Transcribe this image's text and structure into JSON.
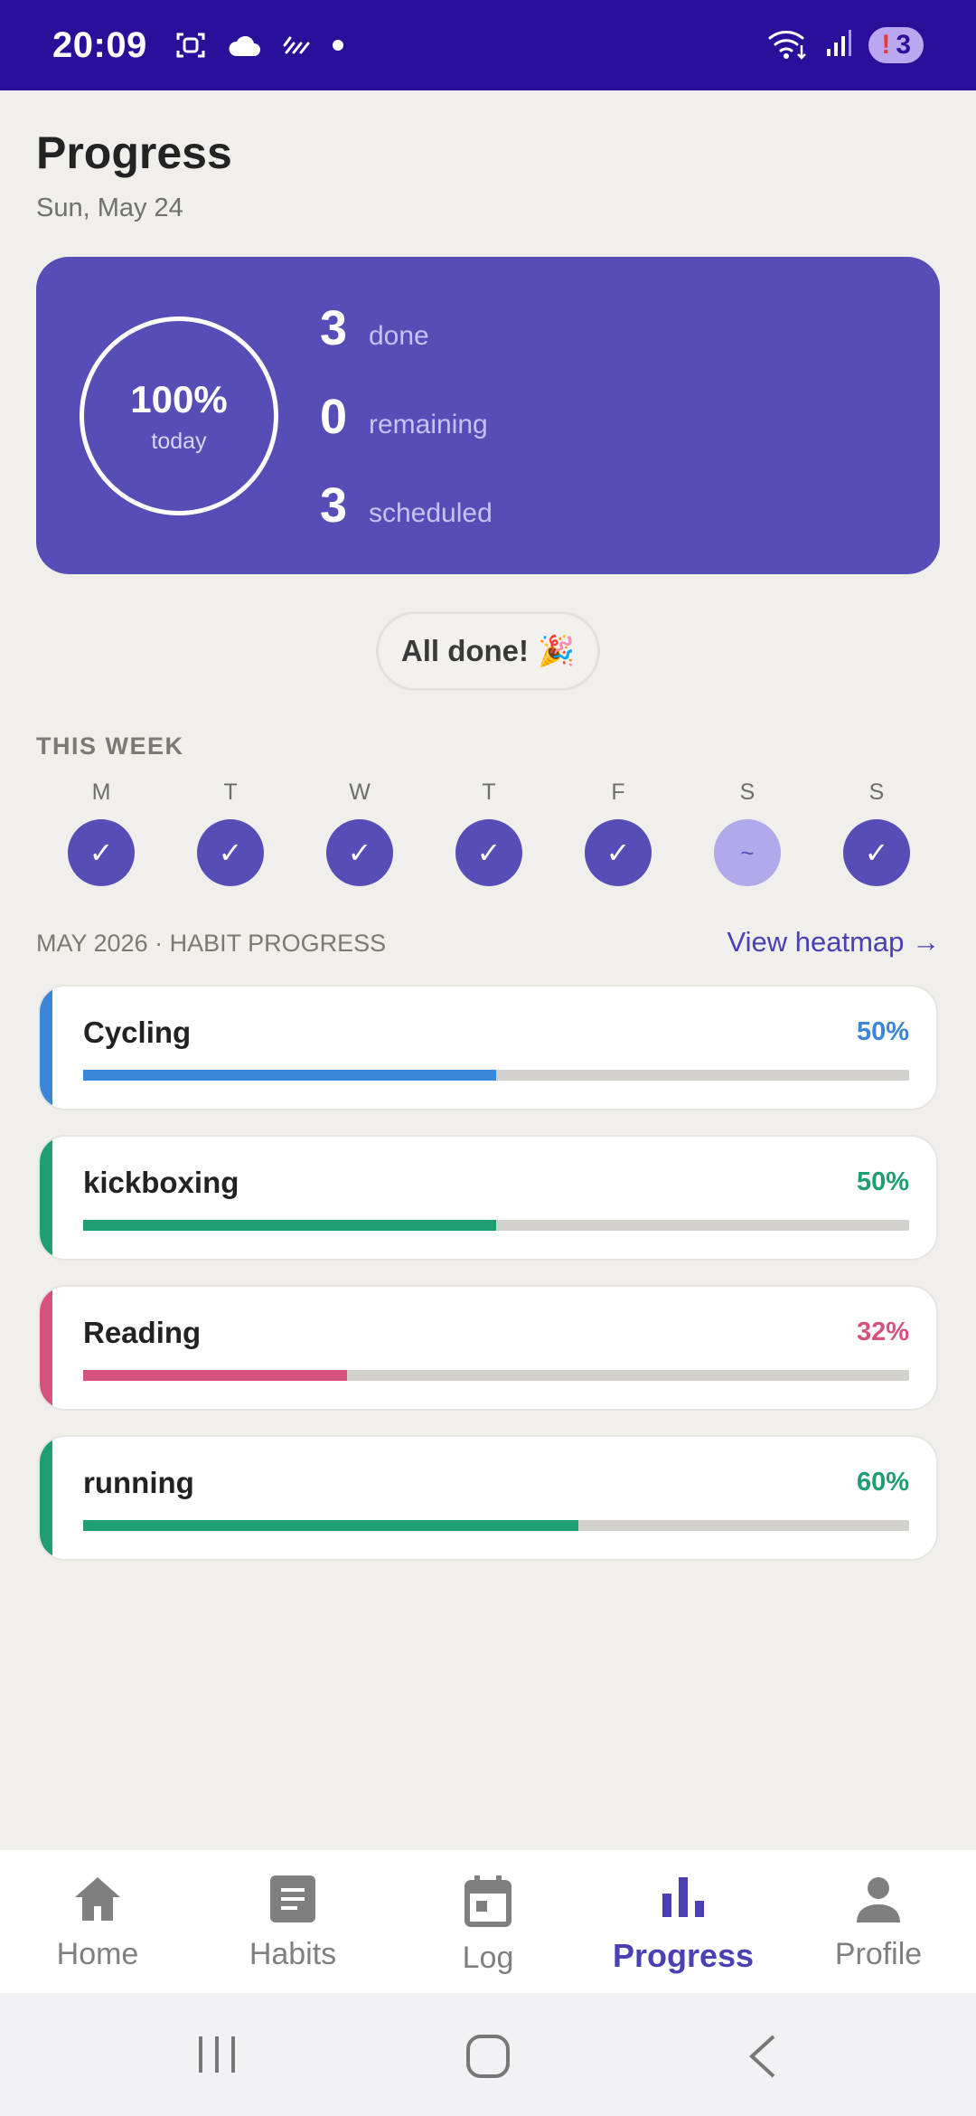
{
  "status_bar": {
    "time": "20:09",
    "notification_count": "3",
    "notification_bang": "!",
    "icons": [
      "screenshot-icon",
      "cloud-icon",
      "weather-icon",
      "dot-icon",
      "wifi-icon",
      "signal-icon"
    ]
  },
  "header": {
    "title": "Progress",
    "date": "Sun, May 24"
  },
  "summary": {
    "percent": "100%",
    "percent_label": "today",
    "percent_value": 1.0,
    "stats": [
      {
        "number": "3",
        "label": "done"
      },
      {
        "number": "0",
        "label": "remaining"
      },
      {
        "number": "3",
        "label": "scheduled"
      }
    ]
  },
  "all_done": {
    "label": "All done!",
    "emoji": "🎉"
  },
  "week": {
    "title": "THIS WEEK",
    "days": [
      {
        "letter": "M",
        "mark": "✓",
        "state": "done"
      },
      {
        "letter": "T",
        "mark": "✓",
        "state": "done"
      },
      {
        "letter": "W",
        "mark": "✓",
        "state": "done"
      },
      {
        "letter": "T",
        "mark": "✓",
        "state": "done"
      },
      {
        "letter": "F",
        "mark": "✓",
        "state": "done"
      },
      {
        "letter": "S",
        "mark": "~",
        "state": "partial"
      },
      {
        "letter": "S",
        "mark": "✓",
        "state": "done"
      }
    ]
  },
  "month": {
    "title": "MAY 2026 · HABIT PROGRESS",
    "view_heatmap": "View heatmap →"
  },
  "habits": [
    {
      "name": "Cycling",
      "percent": "50%",
      "progress": 0.5,
      "color": "#3a86d8"
    },
    {
      "name": "kickboxing",
      "percent": "50%",
      "progress": 0.5,
      "color": "#1f9e74"
    },
    {
      "name": "Reading",
      "percent": "32%",
      "progress": 0.32,
      "color": "#d6517d"
    },
    {
      "name": "running",
      "percent": "60%",
      "progress": 0.6,
      "color": "#1f9e74"
    }
  ],
  "bottom_nav": {
    "items": [
      {
        "label": "Home",
        "icon": "home-icon",
        "active": false
      },
      {
        "label": "Habits",
        "icon": "habits-icon",
        "active": false
      },
      {
        "label": "Log",
        "icon": "calendar-icon",
        "active": false
      },
      {
        "label": "Progress",
        "icon": "bar-chart-icon",
        "active": true
      },
      {
        "label": "Profile",
        "icon": "person-icon",
        "active": false
      }
    ]
  },
  "colors": {
    "accent": "#564db7",
    "status_bar": "#2a0f9a",
    "background": "#f0efec"
  }
}
